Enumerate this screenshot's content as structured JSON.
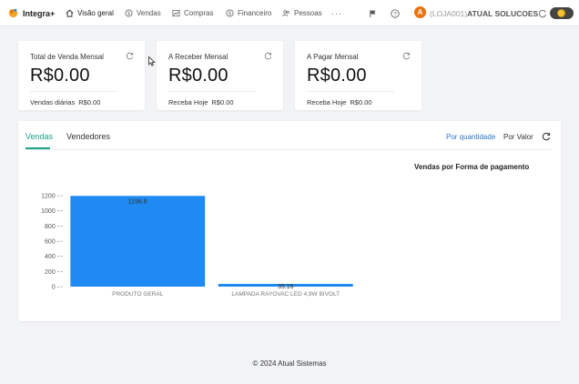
{
  "nav": {
    "brand": "Integra+",
    "items": [
      "Visão geral",
      "Vendas",
      "Compras",
      "Financeiro",
      "Pessoas"
    ],
    "more": "···",
    "avatar": "A",
    "store_code": "(LOJA001)",
    "store_name": "ATUAL SOLUCOES"
  },
  "cards": [
    {
      "title": "Total de Venda Mensal",
      "value": "R$0.00",
      "sub_label": "Vendas diárias",
      "sub_value": "R$0.00"
    },
    {
      "title": "A Receber Mensal",
      "value": "R$0.00",
      "sub_label": "Receba Hoje",
      "sub_value": "R$0.00"
    },
    {
      "title": "A Pagar Mensal",
      "value": "R$0.00",
      "sub_label": "Receba Hoje",
      "sub_value": "R$0.00"
    }
  ],
  "tabs": {
    "vendas": "Vendas",
    "vendedores": "Vendedores"
  },
  "options": {
    "quantidade": "Por quantidade",
    "valor": "Por Valor"
  },
  "chart_data": {
    "type": "bar",
    "title": "Vendas por Forma de pagamento",
    "categories": [
      "PRODUTO GERAL",
      "LAMPADA RAYOVAC LED 4,9W BIVOLT"
    ],
    "values": [
      1196.8,
      35.16
    ],
    "data_labels": [
      "1196.8",
      "35.16"
    ],
    "yticks": [
      0,
      200,
      400,
      600,
      800,
      1000,
      1200
    ],
    "ylim": [
      0,
      1200
    ],
    "bar_color": "#1f8bf2"
  },
  "footer": "2024 Atual Sistemas"
}
